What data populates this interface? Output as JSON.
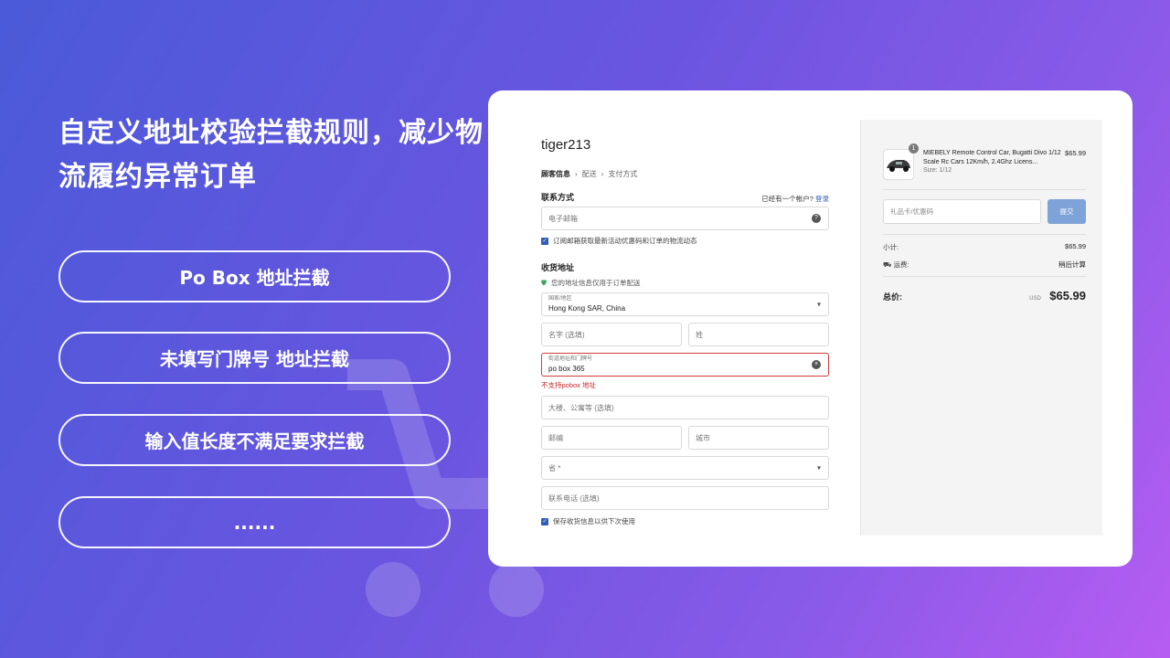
{
  "headline": "自定义地址校验拦截规则，减少物流履约异常订单",
  "features": [
    "Po Box 地址拦截",
    "未填写门牌号 地址拦截",
    "输入值长度不满足要求拦截",
    "......"
  ],
  "checkout": {
    "store_name": "tiger213",
    "breadcrumbs": [
      "顾客信息",
      "配送",
      "支付方式"
    ],
    "contact": {
      "title": "联系方式",
      "have_account": "已经有一个帐户?",
      "login": "登录",
      "email_placeholder": "电子邮箱",
      "subscribe_label": "订阅邮箱获取最新活动优惠码和订单的物流动态"
    },
    "shipping": {
      "title": "收货地址",
      "secure_note": "您的地址信息仅用于订单配送",
      "country_label": "国家/地区",
      "country_value": "Hong Kong SAR, China",
      "first_name_placeholder": "名字 (选填)",
      "last_name_placeholder": "姓",
      "street_label": "街道地址和门牌号",
      "street_value": "po box 365",
      "street_error": "不支持pobox 地址",
      "apartment_placeholder": "大楼、公寓等 (选填)",
      "postcode_placeholder": "邮编",
      "city_placeholder": "城市",
      "province_placeholder": "省 *",
      "phone_placeholder": "联系电话 (选填)",
      "save_info_label": "保存收货信息以供下次使用"
    }
  },
  "summary": {
    "product_name": "MIEBELY Remote Control Car, Bugatti Divo 1/12 Scale Rc Cars 12Km/h, 2.4Ghz Licens...",
    "product_size": "Size: 1/12",
    "product_price": "$65.99",
    "quantity": "1",
    "coupon_placeholder": "礼品卡/优惠码",
    "submit_label": "提交",
    "subtotal_label": "小计:",
    "subtotal_value": "$65.99",
    "shipping_label": "运费:",
    "shipping_value": "稍后计算",
    "total_label": "总价:",
    "currency": "USD",
    "total_value": "$65.99"
  },
  "colors": {
    "accent": "#2f5fb3",
    "error": "#c62b2b",
    "submit": "#7ea3d9"
  }
}
